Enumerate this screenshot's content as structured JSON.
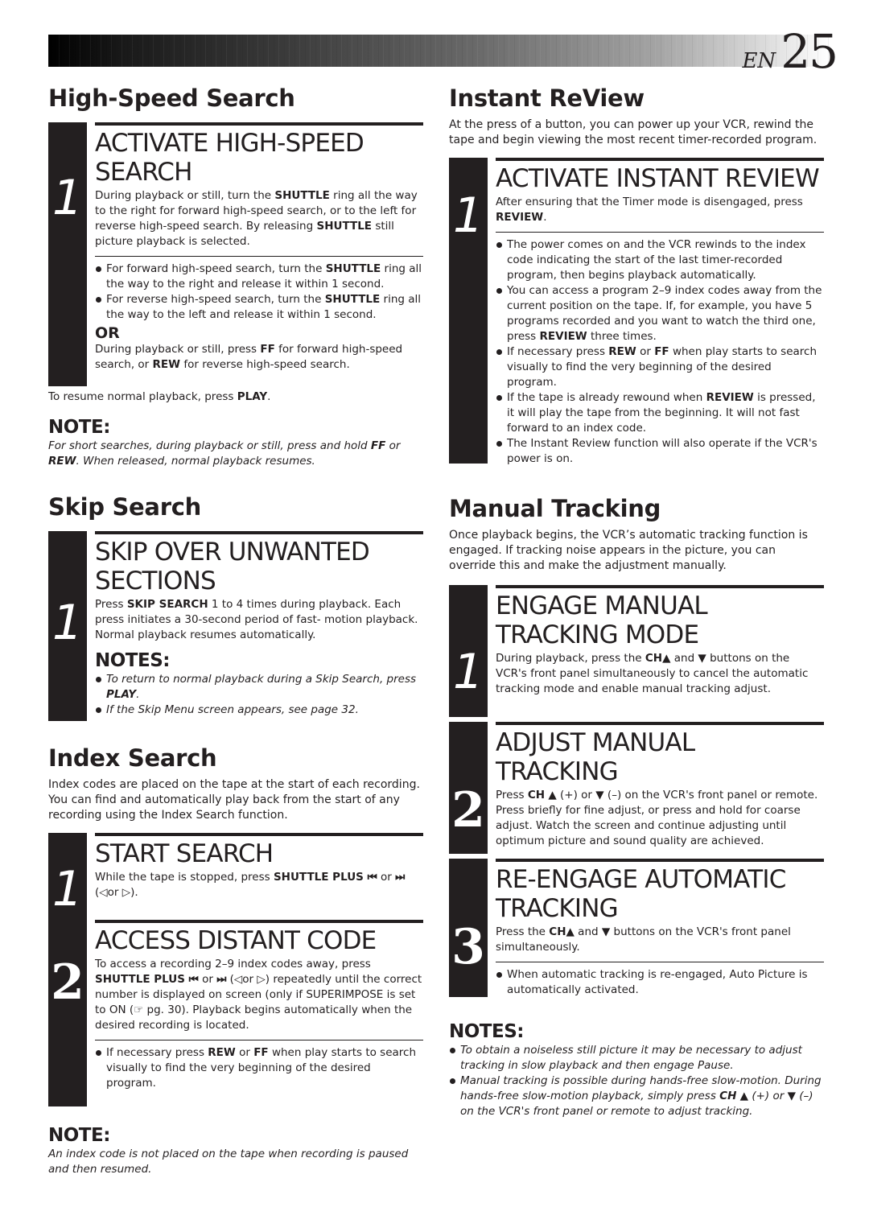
{
  "header": {
    "lang": "EN",
    "page_number": "25"
  },
  "high_speed": {
    "title": "High-Speed Search",
    "step1": {
      "number": "1",
      "title_line1": "ACTIVATE HIGH-SPEED",
      "title_line2": "SEARCH",
      "text_a": "During playback or still, turn the ",
      "text_b": "SHUTTLE",
      "text_c": " ring all the way to the right for forward high-speed search, or to the left for reverse high-speed search. By releasing ",
      "text_d": "SHUTTLE",
      "text_e": " still picture playback is selected.",
      "bullets": [
        {
          "a": "For forward high-speed search, turn the ",
          "b": "SHUTTLE",
          "c": " ring all the way to the right and release it within 1 second."
        },
        {
          "a": "For reverse high-speed search, turn the ",
          "b": "SHUTTLE",
          "c": " ring all the way to the left and release it within 1 second."
        }
      ],
      "or": "OR",
      "alt_a": "During playback or still, press ",
      "alt_b": "FF",
      "alt_c": " for forward high-speed search, or ",
      "alt_d": "REW",
      "alt_e": " for reverse high-speed search."
    },
    "resume_a": "To resume normal playback, press ",
    "resume_b": "PLAY",
    "resume_c": ".",
    "note_heading": "NOTE:",
    "note_a": "For short searches, during playback or still, press and hold ",
    "note_b": "FF",
    "note_c": " or ",
    "note_d": "REW",
    "note_e": ". When released, normal playback resumes."
  },
  "skip": {
    "title": "Skip Search",
    "step1": {
      "number": "1",
      "title_line1": "SKIP OVER UNWANTED",
      "title_line2": "SECTIONS",
      "text_a": "Press ",
      "text_b": "SKIP SEARCH",
      "text_c": " 1 to 4 times during playback. Each press initiates a 30-second period of fast- motion playback. Normal playback resumes automatically.",
      "notes_heading": "NOTES:",
      "notes": [
        {
          "a": "To return to normal playback during a Skip Search, press ",
          "b": "PLAY",
          "c": "."
        },
        {
          "a": "If the Skip Menu screen appears, see page 32.",
          "b": "",
          "c": ""
        }
      ]
    }
  },
  "index": {
    "title": "Index Search",
    "intro": "Index codes are placed on the tape at the start of each recording. You can find and automatically play back from the start of any recording using the Index Search function.",
    "step1": {
      "number": "1",
      "title": "START SEARCH",
      "text_a": "While the tape is stopped, press ",
      "text_b": "SHUTTLE PLUS ⏮",
      "text_c": " or ",
      "text_d": "⏭",
      "text_e": " (◁or ▷)."
    },
    "step2": {
      "number": "2",
      "title": "ACCESS DISTANT CODE",
      "text_a": "To access a recording 2–9 index codes away, press ",
      "text_b": "SHUTTLE PLUS ⏮",
      "text_c": " or ",
      "text_d": "⏭",
      "text_e": " (◁or ▷) repeatedly until the correct number is displayed on screen (only if SUPERIMPOSE is set to ON (☞ pg. 30). Playback begins automatically when the desired recording is located.",
      "bullet_a": "If necessary press ",
      "bullet_b": "REW",
      "bullet_c": " or ",
      "bullet_d": "FF",
      "bullet_e": " when play starts to search visually to find the very beginning of the desired program."
    },
    "note_heading": "NOTE:",
    "note": "An index code is not placed on the tape when recording is paused and then resumed."
  },
  "instant": {
    "title": "Instant ReView",
    "intro": "At the press of a button, you can power up your VCR, rewind the tape and begin viewing the most recent timer-recorded program.",
    "step1": {
      "number": "1",
      "title": "ACTIVATE INSTANT REVIEW",
      "text_a": "After ensuring that the Timer mode is disengaged, press ",
      "text_b": "REVIEW",
      "text_c": ".",
      "bullets": [
        {
          "a": "The power comes on and the VCR rewinds to the index code indicating the start of the last timer-recorded program, then begins playback automatically.",
          "b": "",
          "c": "",
          "d": "",
          "e": ""
        },
        {
          "a": "You can access a program 2–9 index codes away from the current position on the tape. If, for example, you have 5 programs recorded and you want to watch the third one, press ",
          "b": "REVIEW",
          "c": " three times.",
          "d": "",
          "e": ""
        },
        {
          "a": "If necessary press ",
          "b": "REW",
          "c": " or ",
          "d": "FF",
          "e": " when play starts to search visually to find the very beginning of the desired program."
        },
        {
          "a": "If the tape is already rewound when ",
          "b": "REVIEW",
          "c": " is pressed, it will play the tape from the beginning. It will not fast forward to an index code.",
          "d": "",
          "e": ""
        },
        {
          "a": "The Instant Review function will also operate if the VCR's power is on.",
          "b": "",
          "c": "",
          "d": "",
          "e": ""
        }
      ]
    }
  },
  "manual": {
    "title": "Manual Tracking",
    "intro": "Once playback begins, the VCR’s automatic tracking function is engaged. If tracking noise appears in the picture, you can override this and make the adjustment manually.",
    "step1": {
      "number": "1",
      "title_line1": "ENGAGE MANUAL",
      "title_line2": "TRACKING MODE",
      "text_a": "During playback, press the ",
      "text_b": "CH▲",
      "text_c": " and ▼ buttons on the VCR's front panel simultaneously to cancel the automatic tracking mode and enable manual tracking adjust."
    },
    "step2": {
      "number": "2",
      "title_line1": "ADJUST MANUAL",
      "title_line2": "TRACKING",
      "text_a": "Press ",
      "text_b": "CH",
      "text_c": " ▲ (+) or ▼ (–) on the VCR's front panel or remote. Press briefly for fine adjust, or press and hold for coarse adjust. Watch the screen and continue adjusting until optimum picture and sound quality are achieved."
    },
    "step3": {
      "number": "3",
      "title_line1": "RE-ENGAGE AUTOMATIC",
      "title_line2": "TRACKING",
      "text_a": "Press the ",
      "text_b": "CH▲",
      "text_c": " and ▼ buttons on the VCR's front panel simultaneously.",
      "bullet": "When automatic tracking is re-engaged, Auto Picture is automatically activated."
    },
    "notes_heading": "NOTES:",
    "notes": [
      {
        "a": "To obtain a noiseless still picture it may be necessary to adjust tracking in slow playback and then engage Pause.",
        "b": "",
        "c": ""
      },
      {
        "a": "Manual tracking is possible during hands-free slow-motion. During hands-free slow-motion playback, simply press ",
        "b": "CH",
        "c": " ▲ (+) or ▼ (–) on the VCR's front panel or remote to adjust tracking."
      }
    ]
  }
}
